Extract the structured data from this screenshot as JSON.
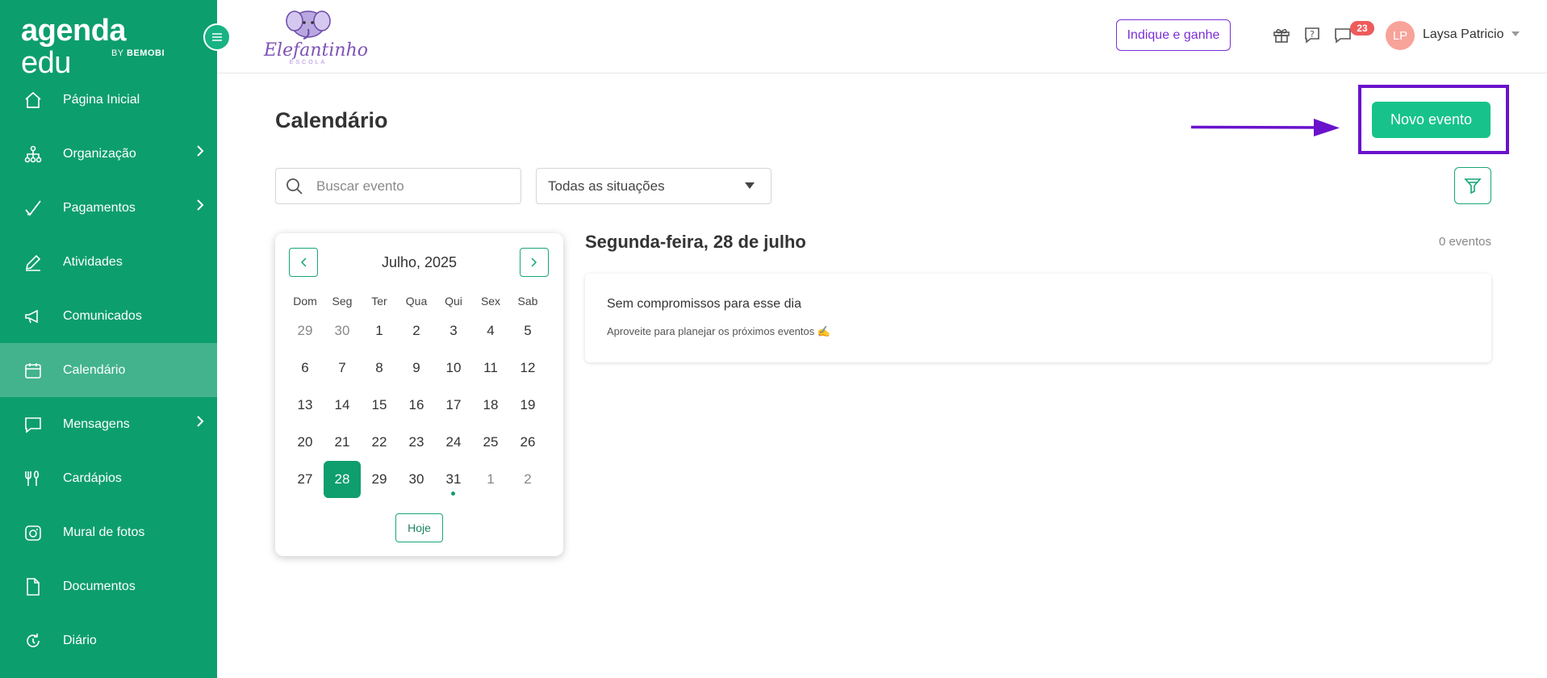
{
  "brand": {
    "main_bold": "agenda",
    "main_light": " edu",
    "sub_prefix": "BY ",
    "sub_bold": "BEMOBI"
  },
  "school": {
    "name": "Elefantinho",
    "sub": "ESCOLA"
  },
  "sidebar": {
    "items": [
      {
        "label": "Página Inicial",
        "icon": "home-icon",
        "has_submenu": false,
        "active": false
      },
      {
        "label": "Organização",
        "icon": "org-chart-icon",
        "has_submenu": true,
        "active": false
      },
      {
        "label": "Pagamentos",
        "icon": "check-icon",
        "has_submenu": true,
        "active": false
      },
      {
        "label": "Atividades",
        "icon": "pencil-icon",
        "has_submenu": false,
        "active": false
      },
      {
        "label": "Comunicados",
        "icon": "megaphone-icon",
        "has_submenu": false,
        "active": false
      },
      {
        "label": "Calendário",
        "icon": "calendar-icon",
        "has_submenu": false,
        "active": true
      },
      {
        "label": "Mensagens",
        "icon": "chat-icon",
        "has_submenu": true,
        "active": false
      },
      {
        "label": "Cardápios",
        "icon": "utensils-icon",
        "has_submenu": false,
        "active": false
      },
      {
        "label": "Mural de fotos",
        "icon": "camera-icon",
        "has_submenu": false,
        "active": false
      },
      {
        "label": "Documentos",
        "icon": "document-icon",
        "has_submenu": false,
        "active": false
      },
      {
        "label": "Diário",
        "icon": "refresh-icon",
        "has_submenu": false,
        "active": false
      }
    ]
  },
  "header": {
    "indique_label": "Indique e ganhe",
    "notifications_count": "23",
    "user_initials": "LP",
    "user_name": "Laysa Patricio"
  },
  "main": {
    "title": "Calendário",
    "new_event_label": "Novo evento",
    "search_placeholder": "Buscar evento",
    "status_filter_value": "Todas as situações"
  },
  "calendar": {
    "month_label": "Julho, 2025",
    "weekdays": [
      "Dom",
      "Seg",
      "Ter",
      "Qua",
      "Qui",
      "Sex",
      "Sab"
    ],
    "weeks": [
      [
        {
          "d": "29",
          "other": true
        },
        {
          "d": "30",
          "other": true
        },
        {
          "d": "1"
        },
        {
          "d": "2"
        },
        {
          "d": "3"
        },
        {
          "d": "4"
        },
        {
          "d": "5"
        }
      ],
      [
        {
          "d": "6"
        },
        {
          "d": "7"
        },
        {
          "d": "8"
        },
        {
          "d": "9"
        },
        {
          "d": "10"
        },
        {
          "d": "11"
        },
        {
          "d": "12"
        }
      ],
      [
        {
          "d": "13"
        },
        {
          "d": "14"
        },
        {
          "d": "15"
        },
        {
          "d": "16"
        },
        {
          "d": "17"
        },
        {
          "d": "18"
        },
        {
          "d": "19"
        }
      ],
      [
        {
          "d": "20"
        },
        {
          "d": "21"
        },
        {
          "d": "22"
        },
        {
          "d": "23"
        },
        {
          "d": "24"
        },
        {
          "d": "25"
        },
        {
          "d": "26"
        }
      ],
      [
        {
          "d": "27"
        },
        {
          "d": "28",
          "selected": true
        },
        {
          "d": "29"
        },
        {
          "d": "30"
        },
        {
          "d": "31",
          "has_event": true
        },
        {
          "d": "1",
          "other": true
        },
        {
          "d": "2",
          "other": true
        }
      ]
    ],
    "today_label": "Hoje"
  },
  "day_panel": {
    "title": "Segunda-feira, 28 de julho",
    "event_count": "0 eventos",
    "empty_title": "Sem compromissos para esse dia",
    "empty_subtitle": "Aproveite para planejar os próximos eventos ✍️"
  },
  "colors": {
    "primary": "#0d9e6e",
    "button_green": "#17c38b",
    "highlight": "#6a12cc",
    "badge": "#ef5b5b"
  }
}
